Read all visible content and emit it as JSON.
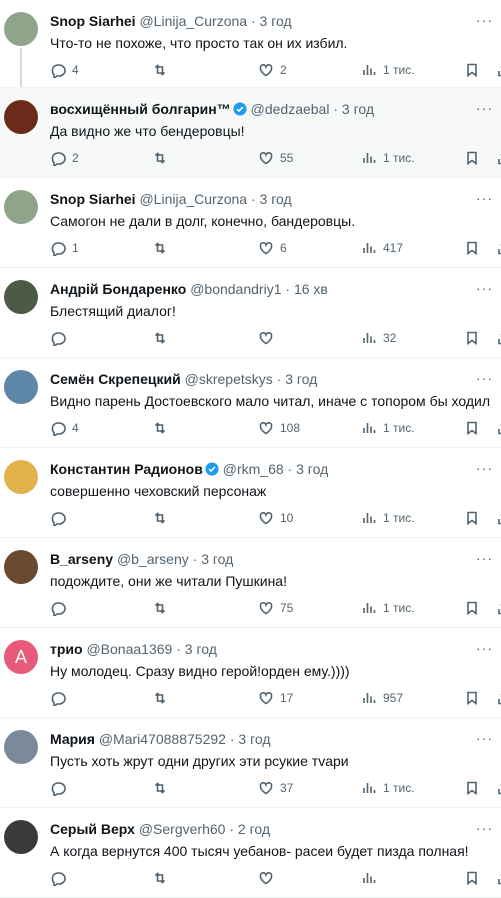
{
  "tweets": [
    {
      "name": "Snop Siarhei",
      "verified": false,
      "handle": "@Linija_Curzona",
      "time": "3 год",
      "text": "Что-то не похоже, что просто так он их избил.",
      "replies": "4",
      "retweets": "",
      "likes": "2",
      "views": "1 тис.",
      "avatar_color": "#8fa58a",
      "avatar_letter": "",
      "highlight": false,
      "thread": true
    },
    {
      "name": "восхищённый болгарин™",
      "verified": true,
      "handle": "@dedzaebal",
      "time": "3 год",
      "text": "Да видно же что бендеровцы!",
      "replies": "2",
      "retweets": "",
      "likes": "55",
      "views": "1 тис.",
      "avatar_color": "#6b2a1a",
      "avatar_letter": "",
      "highlight": true,
      "thread": false
    },
    {
      "name": "Snop Siarhei",
      "verified": false,
      "handle": "@Linija_Curzona",
      "time": "3 год",
      "text": "Самогон не дали в долг, конечно, бандеровцы.",
      "replies": "1",
      "retweets": "",
      "likes": "6",
      "views": "417",
      "avatar_color": "#8fa58a",
      "avatar_letter": "",
      "highlight": false,
      "thread": false
    },
    {
      "name": "Андрій Бондаренко",
      "verified": false,
      "handle": "@bondandriy1",
      "time": "16 хв",
      "text": "Блестящий диалог!",
      "replies": "",
      "retweets": "",
      "likes": "",
      "views": "32",
      "avatar_color": "#4d5a45",
      "avatar_letter": "",
      "highlight": false,
      "thread": false
    },
    {
      "name": "Семён Скрепецкий",
      "verified": false,
      "handle": "@skrepetskys",
      "time": "3 год",
      "text": "Видно парень Достоевского мало читал, иначе с топором бы ходил.",
      "replies": "4",
      "retweets": "",
      "likes": "108",
      "views": "1 тис.",
      "avatar_color": "#5d86a8",
      "avatar_letter": "",
      "highlight": false,
      "thread": false
    },
    {
      "name": "Константин Радионов",
      "verified": true,
      "handle": "@rkm_68",
      "time": "3 год",
      "text": "совершенно чеховский персонаж",
      "replies": "",
      "retweets": "",
      "likes": "10",
      "views": "1 тис.",
      "avatar_color": "#e2b34a",
      "avatar_letter": "",
      "highlight": false,
      "thread": false
    },
    {
      "name": "B_arseny",
      "verified": false,
      "handle": "@b_arseny",
      "time": "3 год",
      "text": "подождите, они же читали Пушкина!",
      "replies": "",
      "retweets": "",
      "likes": "75",
      "views": "1 тис.",
      "avatar_color": "#6a4a30",
      "avatar_letter": "",
      "highlight": false,
      "thread": false
    },
    {
      "name": "трио",
      "verified": false,
      "handle": "@Bonaa1369",
      "time": "3 год",
      "text": "Ну молодец. Сразу видно герой!орден ему.))))",
      "replies": "",
      "retweets": "",
      "likes": "17",
      "views": "957",
      "avatar_color": "#e85a7a",
      "avatar_letter": "A",
      "highlight": false,
      "thread": false
    },
    {
      "name": "Мария",
      "verified": false,
      "handle": "@Mari47088875292",
      "time": "3 год",
      "text": "Пусть хоть жрут одни других эти рсукие тvари",
      "replies": "",
      "retweets": "",
      "likes": "37",
      "views": "1 тис.",
      "avatar_color": "#7a8a9a",
      "avatar_letter": "",
      "highlight": false,
      "thread": false
    },
    {
      "name": "Серый Верх",
      "verified": false,
      "handle": "@Sergverh60",
      "time": "2 год",
      "text": "А когда вернутся 400 тысяч уебанов- расеи будет пизда полная!",
      "replies": "",
      "retweets": "",
      "likes": "",
      "views": "",
      "avatar_color": "#3a3a3a",
      "avatar_letter": "",
      "highlight": false,
      "thread": false
    }
  ],
  "dot_separator": "·",
  "more_glyph": "···",
  "accent": "#1d9bf0"
}
